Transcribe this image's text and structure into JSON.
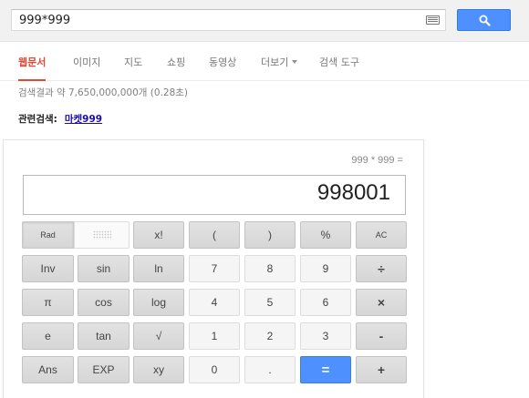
{
  "search": {
    "query": "999*999",
    "keyboard_icon": "keyboard-icon",
    "button_icon": "search-icon",
    "button_color": "#4d90fe"
  },
  "tabs": [
    {
      "label": "웹문서",
      "active": true
    },
    {
      "label": "이미지"
    },
    {
      "label": "지도"
    },
    {
      "label": "쇼핑"
    },
    {
      "label": "동영상"
    },
    {
      "label": "더보기"
    },
    {
      "label": "검색 도구"
    }
  ],
  "results": {
    "stats": "검색결과 약 7,650,000,000개 (0.28초)",
    "related_label": "관련검색:",
    "related_link": "마켓999"
  },
  "calculator": {
    "expression": "999 * 999 =",
    "result": "998001",
    "keys": {
      "rad": "Rad",
      "fact": "x!",
      "lparen": "(",
      "rparen": ")",
      "percent": "%",
      "ac": "AC",
      "inv": "Inv",
      "sin": "sin",
      "ln": "ln",
      "seven": "7",
      "eight": "8",
      "nine": "9",
      "divide": "÷",
      "pi": "π",
      "cos": "cos",
      "log": "log",
      "four": "4",
      "five": "5",
      "six": "6",
      "multiply": "×",
      "e": "e",
      "tan": "tan",
      "sqrt": "√",
      "one": "1",
      "two": "2",
      "three": "3",
      "minus": "-",
      "ans": "Ans",
      "exp": "EXP",
      "pow": "xy",
      "zero": "0",
      "dot": ".",
      "equals": "=",
      "plus": "+"
    }
  }
}
